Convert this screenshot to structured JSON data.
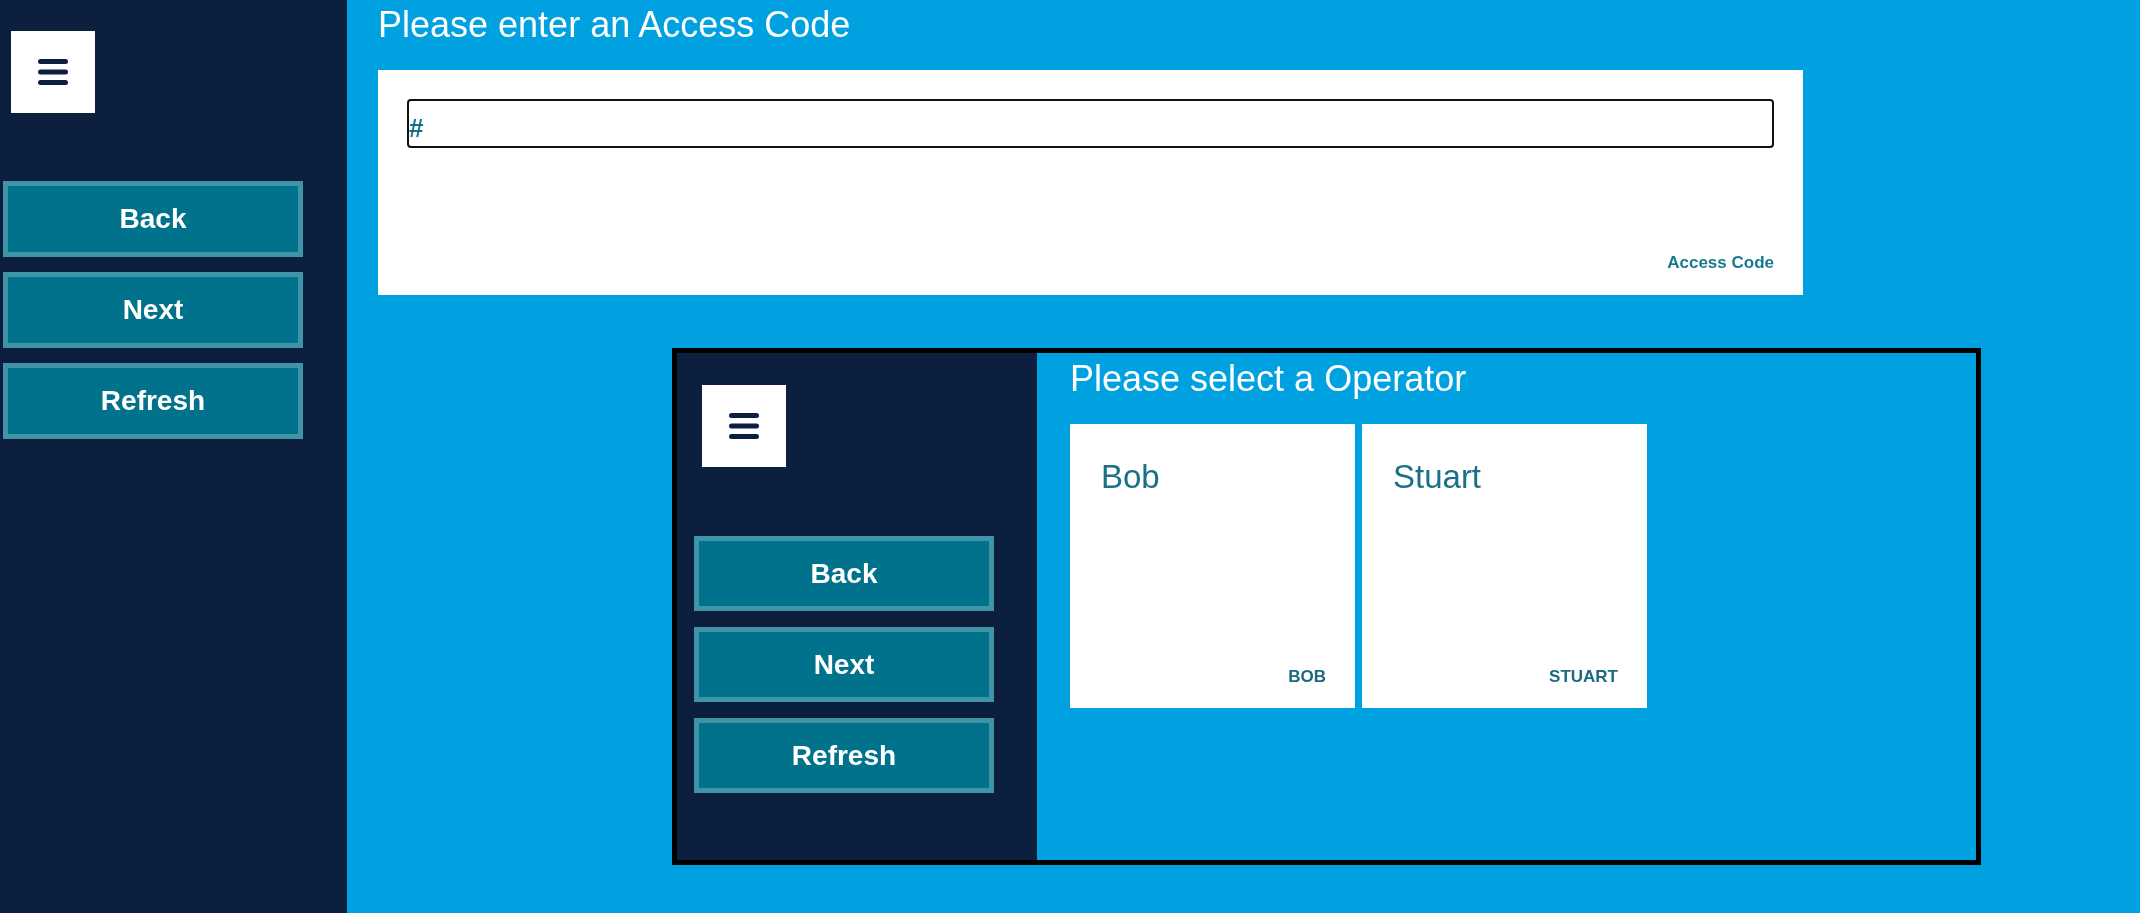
{
  "sidebar": {
    "buttons": [
      "Back",
      "Next",
      "Refresh"
    ]
  },
  "page": {
    "title": "Please enter an Access Code",
    "access_code": {
      "prefix": "#",
      "label": "Access Code"
    }
  },
  "embedded_window": {
    "sidebar": {
      "buttons": [
        "Back",
        "Next",
        "Refresh"
      ]
    },
    "title": "Please select a Operator",
    "operators": [
      {
        "name": "Bob",
        "code": "BOB"
      },
      {
        "name": "Stuart",
        "code": "STUART"
      }
    ]
  }
}
